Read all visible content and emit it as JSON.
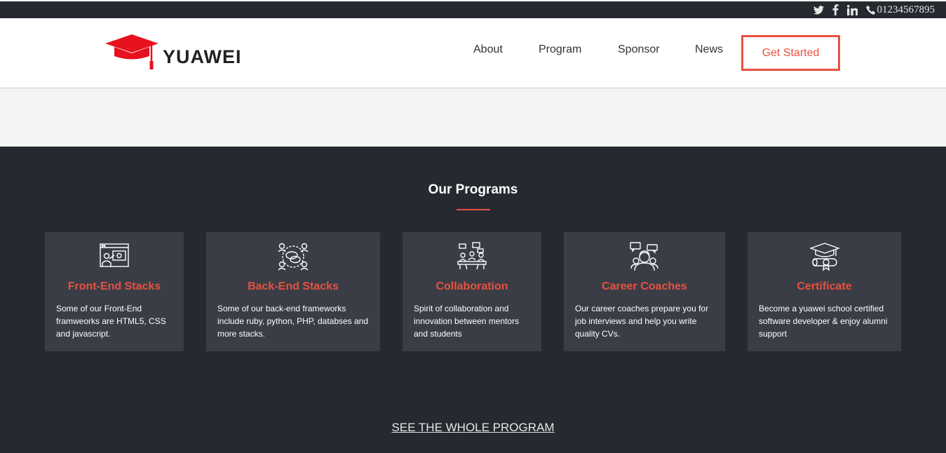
{
  "topbar": {
    "social": [
      {
        "icon": "twitter-icon"
      },
      {
        "icon": "facebook-icon"
      },
      {
        "icon": "linkedin-icon"
      }
    ],
    "phone": "01234567895"
  },
  "header": {
    "logo_text": "YUAWEI",
    "nav": {
      "about": "About",
      "program": "Program",
      "sponsor": "Sponsor",
      "news": "News"
    },
    "cta": "Get Started"
  },
  "programs": {
    "title": "Our Programs",
    "cards": [
      {
        "icon": "webinar-icon",
        "title": "Front-End Stacks",
        "text": "Some of our Front-End framweorks are HTML5, CSS and javascript."
      },
      {
        "icon": "network-chat-icon",
        "title": "Back-End Stacks",
        "text": "Some of our back-end frameworks include ruby, python, PHP, databses and more stacks."
      },
      {
        "icon": "meeting-icon",
        "title": "Collaboration",
        "text": "Spirit of collaboration and innovation between mentors and students"
      },
      {
        "icon": "coaching-icon",
        "title": "Career Coaches",
        "text": "Our career coaches prepare you for job interviews and help you write quality CVs."
      },
      {
        "icon": "diploma-icon",
        "title": "Certificate",
        "text": "Become a yuawei school certified software developer & enjoy alumni support"
      }
    ],
    "see_all": "SEE THE WHOLE PROGRAM"
  },
  "colors": {
    "accent": "#e8513f",
    "dark_bg": "#262930",
    "card_bg": "#3a3d46",
    "hero_bg": "#f4f4f4"
  }
}
